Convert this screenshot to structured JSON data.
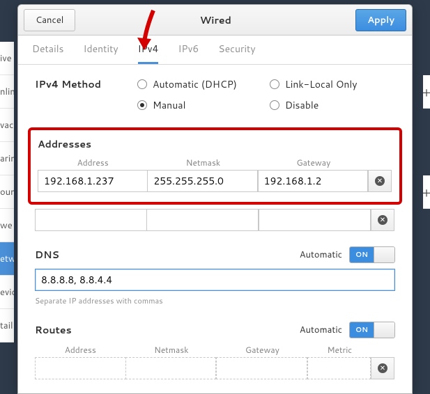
{
  "titlebar": {
    "cancel": "Cancel",
    "title": "Wired",
    "apply": "Apply"
  },
  "tabs": {
    "details": "Details",
    "identity": "Identity",
    "ipv4": "IPv4",
    "ipv6": "IPv6",
    "security": "Security"
  },
  "method": {
    "label": "IPv4 Method",
    "automatic": "Automatic (DHCP)",
    "linklocal": "Link-Local Only",
    "manual": "Manual",
    "disable": "Disable"
  },
  "addresses": {
    "title": "Addresses",
    "col_address": "Address",
    "col_netmask": "Netmask",
    "col_gateway": "Gateway",
    "row0": {
      "address": "192.168.1.237",
      "netmask": "255.255.255.0",
      "gateway": "192.168.1.2"
    },
    "row1": {
      "address": "",
      "netmask": "",
      "gateway": ""
    }
  },
  "dns": {
    "title": "DNS",
    "automatic": "Automatic",
    "switch": "ON",
    "value": "8.8.8.8, 8.8.4.4",
    "hint": "Separate IP addresses with commas"
  },
  "routes": {
    "title": "Routes",
    "automatic": "Automatic",
    "switch": "ON",
    "col_address": "Address",
    "col_netmask": "Netmask",
    "col_gateway": "Gateway",
    "col_metric": "Metric"
  },
  "sidebar": {
    "i0": "ive",
    "i1": "nlin",
    "i2": "vac",
    "i3": "arin",
    "i4": "ounc",
    "i5": "we",
    "i6": "etw",
    "i7": "evic",
    "i8": "tail"
  }
}
